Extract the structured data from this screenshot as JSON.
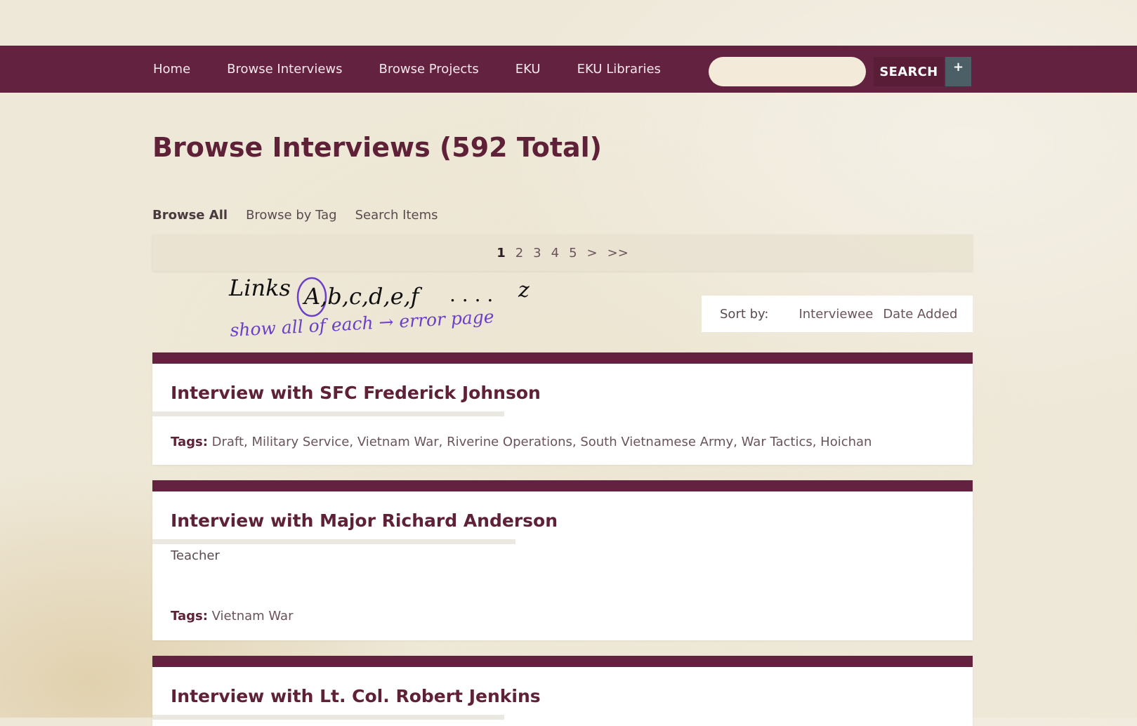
{
  "nav": {
    "links": [
      "Home",
      "Browse Interviews",
      "Browse Projects",
      "EKU",
      "EKU Libraries"
    ],
    "search_placeholder": "",
    "search_button": "SEARCH",
    "advanced_button": "+"
  },
  "page_title": "Browse Interviews (592 Total)",
  "sub_nav": [
    "Browse All",
    "Browse by Tag",
    "Search Items"
  ],
  "pagination": [
    "1",
    "2",
    "3",
    "4",
    "5",
    ">",
    ">>"
  ],
  "annotation": {
    "line1": "Links",
    "letters": "A,b,c,d,e,f",
    "dots": ". . . .",
    "end": "z",
    "line2": "show all of each → error page",
    "ink_primary": "#111111",
    "ink_secondary": "#6b3fc9"
  },
  "sort": {
    "label": "Sort by:",
    "options": [
      "Interviewee",
      "Date Added"
    ]
  },
  "results": [
    {
      "title": "Interview with SFC Frederick Johnson",
      "description": "",
      "tags_label": "Tags:",
      "tags": "Draft, Military Service, Vietnam War, Riverine Operations, South Vietnamese Army, War Tactics, Hoichan"
    },
    {
      "title": "Interview with Major Richard Anderson",
      "description": "Teacher",
      "tags_label": "Tags:",
      "tags": "Vietnam War"
    },
    {
      "title": "Interview with Lt. Col. Robert Jenkins",
      "description": "",
      "tags_label": "",
      "tags": ""
    }
  ],
  "colors": {
    "brand": "#63223f",
    "background": "#eee8d8",
    "search_field": "#f4ead9",
    "advanced_button": "#4c5f66"
  }
}
